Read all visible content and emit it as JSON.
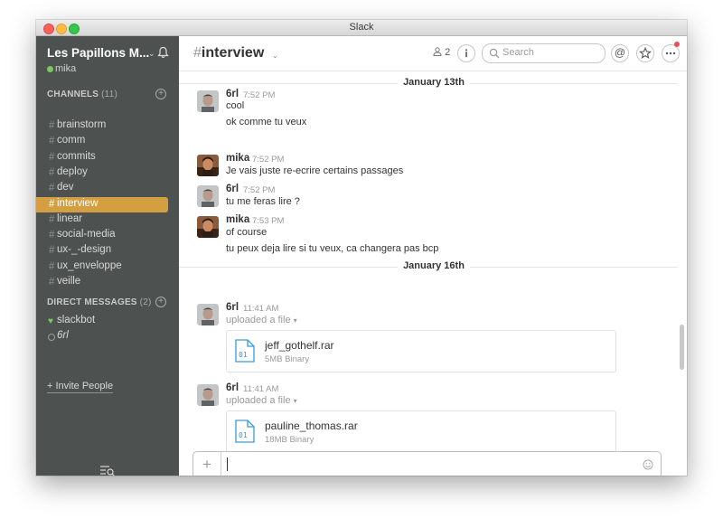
{
  "window": {
    "title": "Slack"
  },
  "sidebar": {
    "team_name": "Les Papillons M...",
    "user": "mika",
    "channels_heading": "CHANNELS",
    "channels_count": "(11)",
    "channels": [
      {
        "label": "brainstorm"
      },
      {
        "label": "comm"
      },
      {
        "label": "commits"
      },
      {
        "label": "deploy"
      },
      {
        "label": "dev"
      },
      {
        "label": "interview",
        "active": true
      },
      {
        "label": "linear"
      },
      {
        "label": "social-media"
      },
      {
        "label": "ux-_-design"
      },
      {
        "label": "ux_enveloppe"
      },
      {
        "label": "veille"
      }
    ],
    "dm_heading": "DIRECT MESSAGES",
    "dm_count": "(2)",
    "dms": [
      {
        "label": "slackbot",
        "status": "heart"
      },
      {
        "label": "6rl",
        "status": "away"
      }
    ],
    "invite_label": "+ Invite People"
  },
  "header": {
    "channel_name": "interview",
    "member_count": "2",
    "search_placeholder": "Search"
  },
  "days": [
    {
      "label": "January 13th",
      "messages": [
        {
          "author": "6rl",
          "time": "7:52 PM",
          "lines": [
            "cool",
            "ok comme tu veux"
          ]
        },
        {
          "author": "mika",
          "time": "7:52 PM",
          "lines": [
            "Je vais juste re-ecrire certains passages"
          ]
        },
        {
          "author": "6rl",
          "time": "7:52 PM",
          "lines": [
            "tu me feras lire ?"
          ]
        },
        {
          "author": "mika",
          "time": "7:53 PM",
          "lines": [
            "of course",
            "tu peux deja lire si tu veux, ca changera pas bcp"
          ]
        }
      ]
    },
    {
      "label": "January 16th",
      "messages": [
        {
          "author": "6rl",
          "time": "11:41 AM",
          "action": "uploaded a file",
          "file": {
            "name": "jeff_gothelf.rar",
            "meta": "5MB Binary"
          }
        },
        {
          "author": "6rl",
          "time": "11:41 AM",
          "action": "uploaded a file",
          "file": {
            "name": "pauline_thomas.rar",
            "meta": "18MB Binary"
          }
        }
      ]
    }
  ],
  "composer": {
    "plus_label": "+",
    "value": ""
  },
  "colors": {
    "sidebar": "#4d5150",
    "active_channel": "#d49f41",
    "presence": "#7bc863",
    "notification": "#eb4d5c"
  }
}
